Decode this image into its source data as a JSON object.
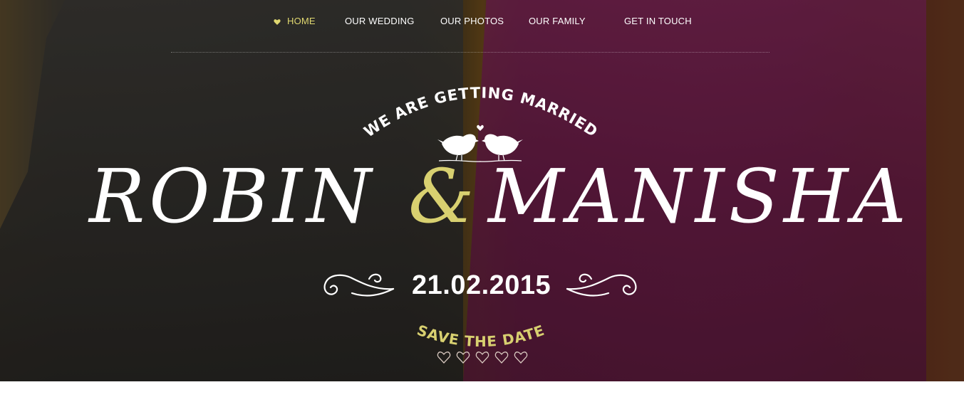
{
  "nav": {
    "items": [
      {
        "label": "HOME",
        "active": true
      },
      {
        "label": "OUR WEDDING",
        "active": false
      },
      {
        "label": "OUR PHOTOS",
        "active": false
      },
      {
        "label": "OUR FAMILY",
        "active": false
      },
      {
        "label": "GET IN TOUCH",
        "active": false
      }
    ],
    "active_icon": "heart-icon"
  },
  "hero": {
    "tagline": "WE ARE GETTING MARRIED",
    "name_left": "ROBIN",
    "ampersand": "&",
    "name_right": "MANISHA",
    "date": "21.02.2015",
    "save_the_date": "SAVE THE DATE",
    "birds_icon": "love-birds-icon",
    "flourish_icon": "flourish-icon",
    "hearts_icon": "hearts-row-icon",
    "heart_count": 5
  },
  "colors": {
    "accent": "#d8d070",
    "text": "#ffffff"
  }
}
